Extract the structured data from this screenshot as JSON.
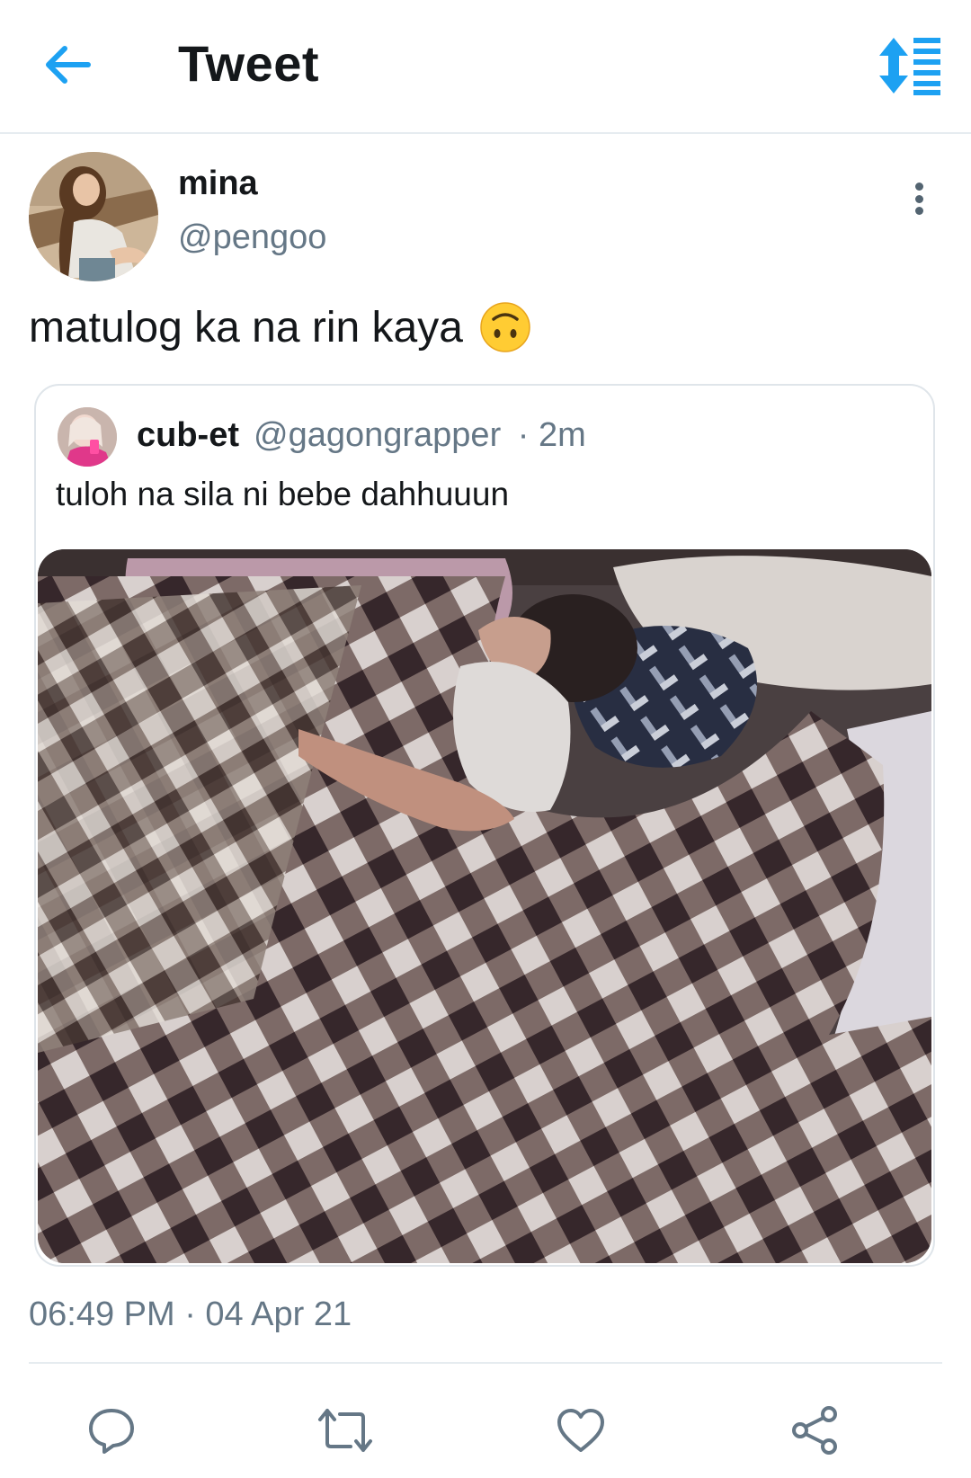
{
  "header": {
    "title": "Tweet",
    "back_icon": "arrow-left-icon",
    "sort_icon": "sort-thread-icon",
    "accent_color": "#1da1f2"
  },
  "tweet": {
    "display_name": "mina",
    "handle": "@pengoo",
    "text": "matulog ka na rin kaya",
    "emoji": "upside-down-face",
    "timestamp": "06:49 PM · 04 Apr 21",
    "quoted": {
      "display_name": "cub-et",
      "handle": "@gagongrapper",
      "age": "· 2m",
      "text": "tuloh na sila ni bebe dahhuuun"
    }
  },
  "actions": {
    "reply_icon": "reply-icon",
    "retweet_icon": "retweet-icon",
    "like_icon": "heart-icon",
    "share_icon": "share-icon"
  }
}
